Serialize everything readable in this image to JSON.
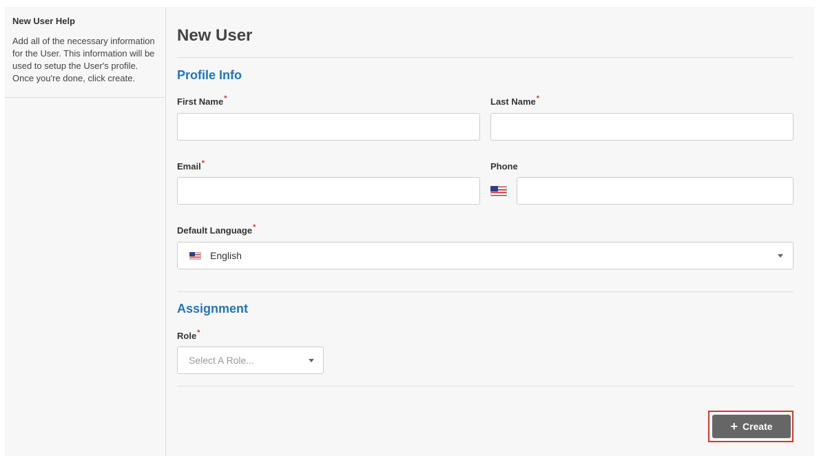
{
  "sidebar": {
    "help_title": "New User Help",
    "help_text": "Add all of the necessary information for the User. This information will be used to setup the User's profile. Once you're done, click create."
  },
  "page": {
    "title": "New User"
  },
  "profile": {
    "section_title": "Profile Info",
    "first_name": {
      "label": "First Name",
      "required": "*",
      "value": ""
    },
    "last_name": {
      "label": "Last Name",
      "required": "*",
      "value": ""
    },
    "email": {
      "label": "Email",
      "required": "*",
      "value": ""
    },
    "phone": {
      "label": "Phone",
      "value": "",
      "country_icon": "us-flag-icon"
    },
    "language": {
      "label": "Default Language",
      "required": "*",
      "selected": "English",
      "icon": "us-flag-icon"
    }
  },
  "assignment": {
    "section_title": "Assignment",
    "role": {
      "label": "Role",
      "required": "*",
      "placeholder": "Select A Role..."
    }
  },
  "actions": {
    "create_label": "Create",
    "create_icon": "plus-icon"
  },
  "colors": {
    "section_title": "#1f76c0",
    "required_marker": "#d9362c",
    "button_bg": "#666666",
    "highlight": "#d9362c"
  }
}
